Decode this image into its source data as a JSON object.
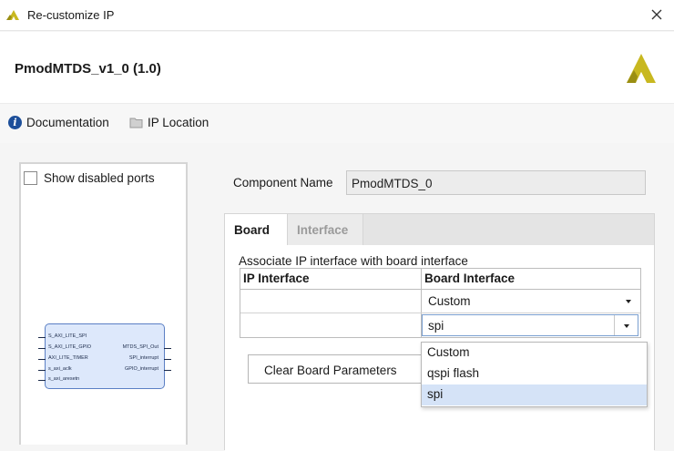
{
  "window": {
    "title": "Re-customize IP",
    "close_icon": "close-icon"
  },
  "header": {
    "ip_title": "PmodMTDS_v1_0 (1.0)"
  },
  "links": {
    "documentation": "Documentation",
    "ip_location": "IP Location"
  },
  "left_panel": {
    "show_disabled_ports": "Show disabled ports",
    "block": {
      "ports_left": [
        "S_AXI_LITE_SPI",
        "S_AXI_LITE_GPIO",
        "AXI_LITE_TIMER",
        "s_axi_aclk",
        "s_axi_aresetn"
      ],
      "ports_right": [
        "MTDS_SPI_Out",
        "SPI_interrupt",
        "GPIO_interrupt"
      ]
    }
  },
  "component": {
    "label": "Component Name",
    "value": "PmodMTDS_0"
  },
  "tabs": [
    {
      "label": "Board"
    },
    {
      "label": "Interface"
    }
  ],
  "board_tab": {
    "description": "Associate IP interface with board interface",
    "columns": [
      "IP Interface",
      "Board Interface"
    ],
    "rows": [
      {
        "ip_interface": "",
        "board_interface": "Custom"
      },
      {
        "ip_interface": "",
        "board_interface": "spi"
      }
    ],
    "clear_button": "Clear Board Parameters",
    "dropdown_options": [
      "Custom",
      "qspi flash",
      "spi"
    ],
    "dropdown_selected": "spi"
  },
  "colors": {
    "accent": "#1d4f9a",
    "brand_logo": "#c8b820",
    "block_fill": "#dde8fb",
    "selection": "#d5e3f7"
  }
}
